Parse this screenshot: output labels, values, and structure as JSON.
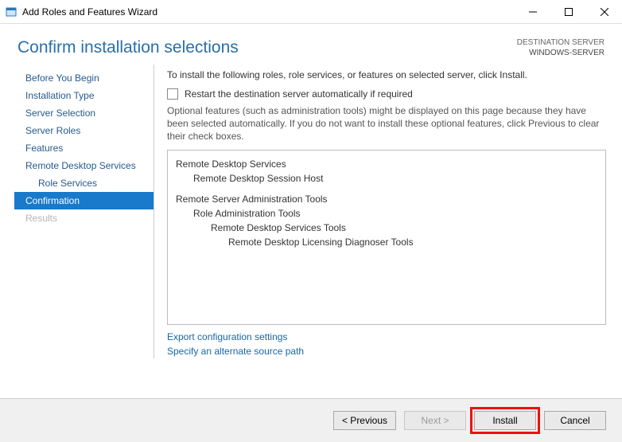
{
  "window": {
    "title": "Add Roles and Features Wizard"
  },
  "header": {
    "title": "Confirm installation selections",
    "destination_label": "DESTINATION SERVER",
    "destination_value": "WINDOWS-SERVER"
  },
  "sidebar": {
    "items": [
      {
        "label": "Before You Begin",
        "state": "normal"
      },
      {
        "label": "Installation Type",
        "state": "normal"
      },
      {
        "label": "Server Selection",
        "state": "normal"
      },
      {
        "label": "Server Roles",
        "state": "normal"
      },
      {
        "label": "Features",
        "state": "normal"
      },
      {
        "label": "Remote Desktop Services",
        "state": "normal"
      },
      {
        "label": "Role Services",
        "state": "normal",
        "indent": true
      },
      {
        "label": "Confirmation",
        "state": "selected"
      },
      {
        "label": "Results",
        "state": "dim"
      }
    ]
  },
  "content": {
    "intro": "To install the following roles, role services, or features on selected server, click Install.",
    "restart_label": "Restart the destination server automatically if required",
    "restart_checked": false,
    "optional_note": "Optional features (such as administration tools) might be displayed on this page because they have been selected automatically. If you do not want to install these optional features, click Previous to clear their check boxes.",
    "selected_items": [
      {
        "text": "Remote Desktop Services",
        "level": 1
      },
      {
        "text": "Remote Desktop Session Host",
        "level": 2
      },
      {
        "text": "Remote Server Administration Tools",
        "level": 1
      },
      {
        "text": "Role Administration Tools",
        "level": 2
      },
      {
        "text": "Remote Desktop Services Tools",
        "level": 3
      },
      {
        "text": "Remote Desktop Licensing Diagnoser Tools",
        "level": 4
      }
    ],
    "links": {
      "export": "Export configuration settings",
      "source": "Specify an alternate source path"
    }
  },
  "buttons": {
    "previous": "< Previous",
    "next": "Next >",
    "install": "Install",
    "cancel": "Cancel"
  }
}
